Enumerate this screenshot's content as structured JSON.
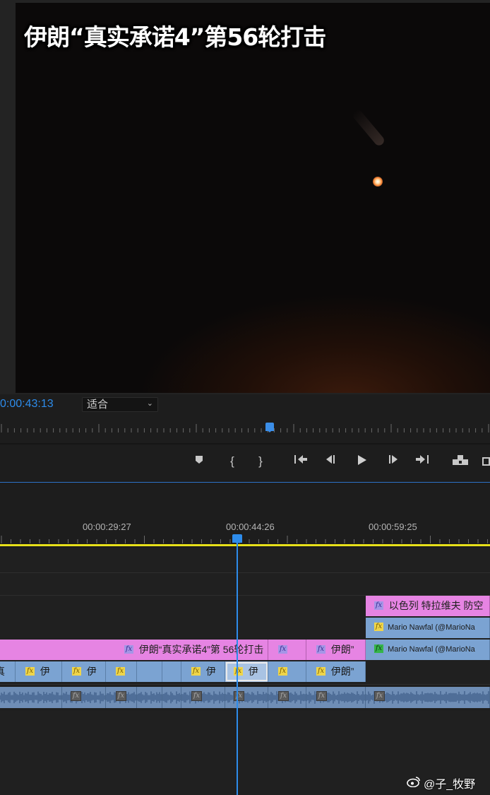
{
  "monitor": {
    "video_title": "伊朗“真实承诺4”第56轮打击",
    "timecode": "0:00:43:13",
    "fit_select": "适合"
  },
  "transport": {
    "icons": [
      "marker-icon",
      "mark-in-icon",
      "mark-out-icon",
      "go-to-in-icon",
      "step-back-icon",
      "play-icon",
      "step-forward-icon",
      "go-to-out-icon",
      "lift-icon",
      "extract-icon"
    ]
  },
  "timeline": {
    "ruler_labels": [
      "00:00:29:27",
      "00:00:44:26",
      "00:00:59:25"
    ],
    "colors": {
      "playhead": "#2d8ceb",
      "work_area": "#e7e019",
      "pink_clip": "#e684e3",
      "blue_clip": "#7ba3d2"
    },
    "v4_clip": {
      "label": "以色列 特拉维夫 防空"
    },
    "v3_clip": {
      "label": "Mario Nawfal (@MarioNa"
    },
    "v2_clips": [
      {
        "label": "伊朗“真实承诺4”第 56轮打击"
      },
      {
        "label": ""
      },
      {
        "label": "伊朗”"
      },
      {
        "label": "Mario Nawfal (@MarioNa"
      }
    ],
    "v1_clips": [
      {
        "label": "真"
      },
      {
        "label": "伊"
      },
      {
        "label": "伊"
      },
      {
        "label": ""
      },
      {
        "label": "伊"
      },
      {
        "label": "伊"
      },
      {
        "label": ""
      },
      {
        "label": "伊朗”"
      }
    ]
  },
  "watermark": "@子_牧野"
}
